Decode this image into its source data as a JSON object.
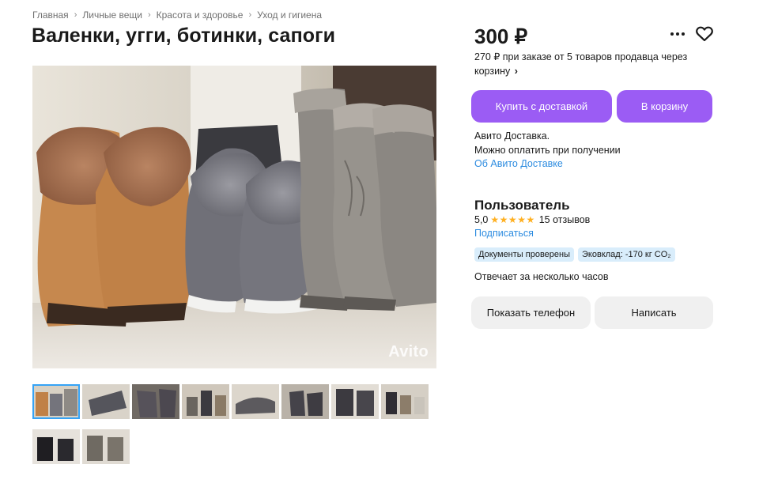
{
  "breadcrumbs": [
    {
      "label": "Главная"
    },
    {
      "label": "Личные вещи"
    },
    {
      "label": "Красота и здоровье"
    },
    {
      "label": "Уход и гигиена"
    }
  ],
  "breadcrumb_separator": "›",
  "title": "Валенки, угги, ботинки, сапоги",
  "gallery": {
    "watermark": "Avito",
    "thumb_count": 10,
    "active_index": 0
  },
  "offer": {
    "price": "300 ₽",
    "bulk_price_text": "270 ₽ при заказе от 5 товаров продавца через корзину",
    "bulk_arrow": "›",
    "buy_delivery_label": "Купить с доставкой",
    "add_to_cart_label": "В корзину",
    "more_icon": "more-dots-icon",
    "favorite_icon": "heart-icon"
  },
  "delivery": {
    "line1": "Авито Доставка.",
    "line2": "Можно оплатить при получении",
    "link": "Об Авито Доставке"
  },
  "seller": {
    "name": "Пользователь",
    "rating": "5,0",
    "stars": 5,
    "reviews": "15 отзывов",
    "subscribe": "Подписаться",
    "badges": [
      "Документы проверены",
      "Эковклад: -170 кг CO₂"
    ],
    "response_time": "Отвечает за несколько часов"
  },
  "contact": {
    "show_phone": "Показать телефон",
    "write": "Написать"
  },
  "colors": {
    "accent": "#9b5cf4",
    "link": "#2d8ce0",
    "star": "#ffb021",
    "badge_bg": "#d9edfb",
    "secondary_btn": "#f0f0f0"
  }
}
